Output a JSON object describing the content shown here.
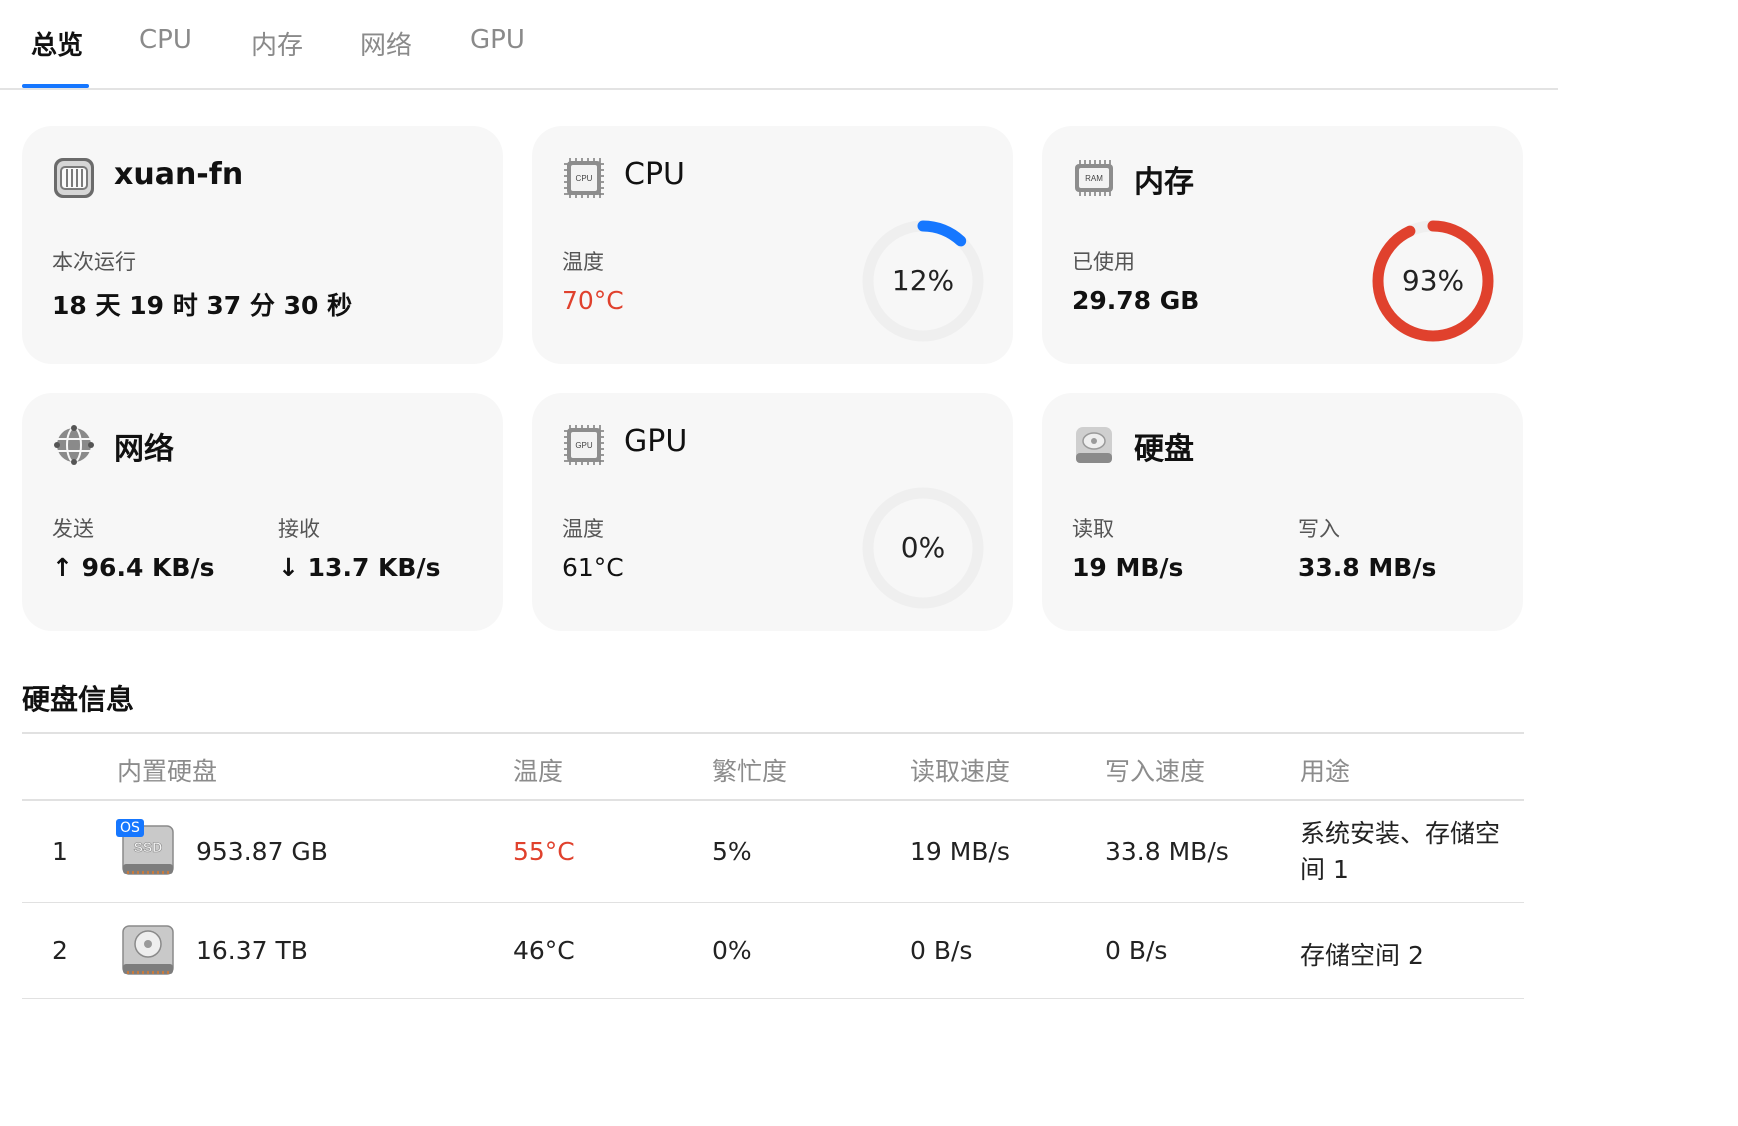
{
  "tabs": [
    {
      "label": "总览"
    },
    {
      "label": "CPU"
    },
    {
      "label": "内存"
    },
    {
      "label": "网络"
    },
    {
      "label": "GPU"
    }
  ],
  "cards": {
    "device": {
      "title": "xuan-fn",
      "uptime_label": "本次运行",
      "uptime_value": "18 天 19 时 37 分 30 秒"
    },
    "cpu": {
      "title": "CPU",
      "temp_label": "温度",
      "temp_value": "70°C",
      "usage_text": "12%",
      "usage_fraction": 0.12,
      "icon_text": "CPU"
    },
    "memory": {
      "title": "内存",
      "used_label": "已使用",
      "used_value": "29.78 GB",
      "usage_text": "93%",
      "usage_fraction": 0.93,
      "icon_text": "RAM"
    },
    "network": {
      "title": "网络",
      "send_label": "发送",
      "send_value": "↑ 96.4 KB/s",
      "recv_label": "接收",
      "recv_value": "↓ 13.7 KB/s"
    },
    "gpu": {
      "title": "GPU",
      "temp_label": "温度",
      "temp_value": "61°C",
      "usage_text": "0%",
      "usage_fraction": 0.0,
      "icon_text": "GPU"
    },
    "disk": {
      "title": "硬盘",
      "read_label": "读取",
      "read_value": "19 MB/s",
      "write_label": "写入",
      "write_value": "33.8 MB/s"
    }
  },
  "disk_info": {
    "title": "硬盘信息",
    "headers": [
      "内置硬盘",
      "温度",
      "繁忙度",
      "读取速度",
      "写入速度",
      "用途"
    ],
    "rows": [
      {
        "index": "1",
        "badge": "OS",
        "icon": "ssd-icon",
        "icon_text": "SSD",
        "capacity": "953.87 GB",
        "temp": "55°C",
        "busy": "5%",
        "read": "19 MB/s",
        "write": "33.8 MB/s",
        "usage": "系统安装、存储空间 1"
      },
      {
        "index": "2",
        "badge": "",
        "icon": "hdd-icon",
        "capacity": "16.37 TB",
        "temp": "46°C",
        "busy": "0%",
        "read": "0 B/s",
        "write": "0 B/s",
        "usage": "存储空间 2"
      }
    ]
  },
  "colors": {
    "accent": "#1677ff",
    "hot": "#e0412d",
    "ring_track": "#efefef",
    "card_bg": "#f7f7f7"
  }
}
